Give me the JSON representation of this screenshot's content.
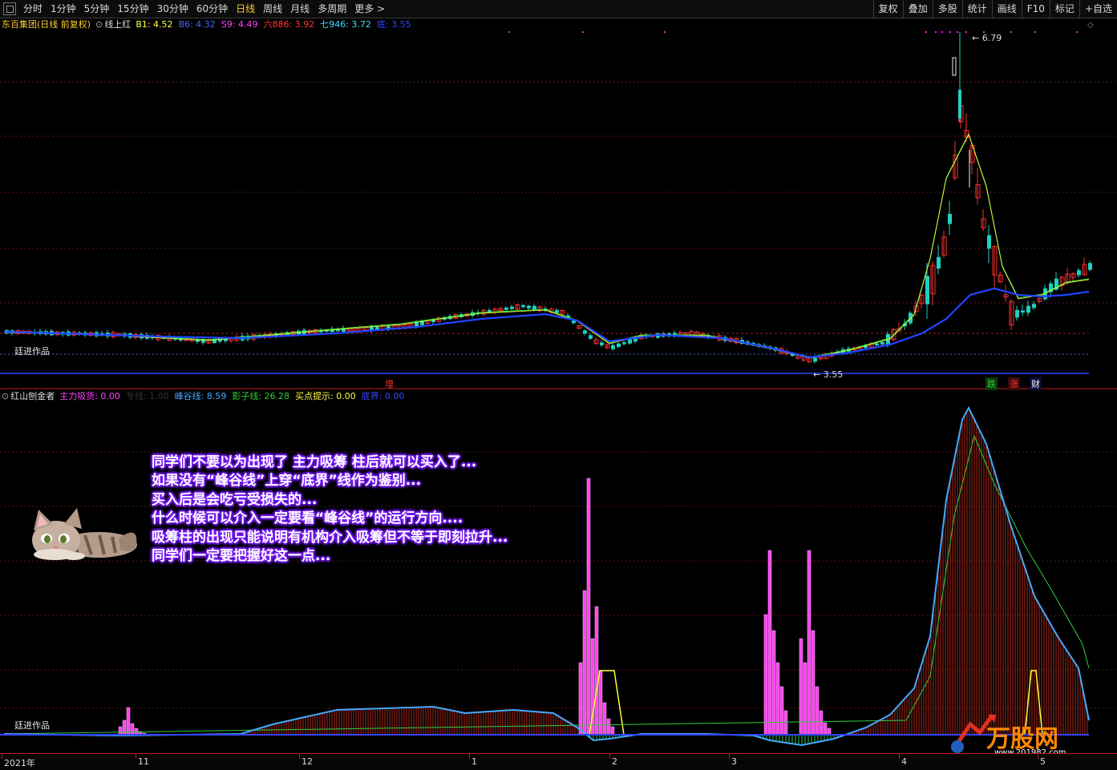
{
  "toolbar": {
    "periods": [
      "分时",
      "1分钟",
      "5分钟",
      "15分钟",
      "30分钟",
      "60分钟",
      "日线",
      "周线",
      "月线",
      "多周期",
      "更多 >"
    ],
    "active_period": "日线",
    "right_buttons": [
      "复权",
      "叠加",
      "多股",
      "统计",
      "画线",
      "F10",
      "标记",
      "+自选"
    ]
  },
  "main_panel": {
    "stock_name": "东百集团(日线 前复权)",
    "indicator": "线上红",
    "legend": [
      {
        "label": "B1: 4.52",
        "color": "#ffff44"
      },
      {
        "label": "B6: 4.32",
        "color": "#4466ff"
      },
      {
        "label": "S9: 4.49",
        "color": "#ff44ff"
      },
      {
        "label": "六886: 3.92",
        "color": "#ff3333"
      },
      {
        "label": "七946: 3.72",
        "color": "#44ddff"
      },
      {
        "label": "底: 3.55",
        "color": "#3344ff"
      }
    ],
    "high_label": "6.79",
    "low_label": "3.55",
    "watermark": "廷进作品",
    "markers": [
      {
        "text": "增",
        "color": "#ff3333"
      },
      {
        "text": "跌",
        "color": "#33cc33"
      },
      {
        "text": "涨",
        "color": "#ff3333"
      },
      {
        "text": "财",
        "color": "#ffffff"
      }
    ]
  },
  "sub_panel": {
    "name": "红山刨金者",
    "legend": [
      {
        "label": "主力吸货: 0.00",
        "color": "#ff44ff"
      },
      {
        "label": "专线: 1.00",
        "color": "#333333"
      },
      {
        "label": "峰谷线: 8.59",
        "color": "#44aaff"
      },
      {
        "label": "影子线: 26.28",
        "color": "#33cc33"
      },
      {
        "label": "买点提示: 0.00",
        "color": "#ffff44"
      },
      {
        "label": "底界: 0.00",
        "color": "#3344ff"
      }
    ],
    "watermark": "廷进作品",
    "annotation": [
      "同学们不要以为出现了 主力吸筹 柱后就可以买入了...",
      "如果没有“峰谷线”上穿“底界”线作为鉴别...",
      "买入后是会吃亏受损失的...",
      "什么时候可以介入一定要看“峰谷线”的运行方向....",
      "吸筹柱的出现只能说明有机构介入吸筹但不等于即刻拉升...",
      "同学们一定要把握好这一点..."
    ],
    "logo_text": "万股网",
    "logo_url": "www.201982.com"
  },
  "xaxis": {
    "labels": [
      "2021年",
      "11",
      "12",
      "1",
      "2",
      "3",
      "4",
      "5"
    ]
  }
}
